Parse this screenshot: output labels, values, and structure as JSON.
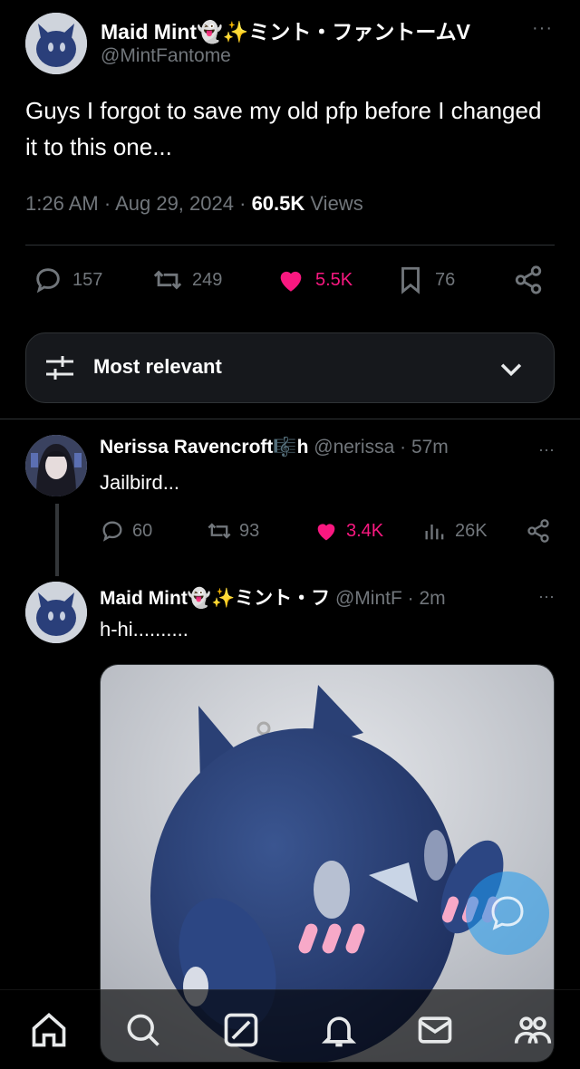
{
  "main_tweet": {
    "display_name": "Maid Mint👻✨ミント・ファントームV",
    "handle": "@MintFantome",
    "more_label": "···",
    "text": "Guys I forgot to save my old pfp before I changed it to this one...",
    "time": "1:26 AM",
    "date": "Aug 29, 2024",
    "views_count": "60.5K",
    "views_label": "Views",
    "replies": "157",
    "reposts": "249",
    "likes": "5.5K",
    "bookmarks": "76",
    "icons": [
      "reply-icon",
      "repost-icon",
      "like-icon",
      "bookmark-icon",
      "share-icon"
    ],
    "like_color": "#f91880"
  },
  "sort": {
    "label": "Most relevant",
    "icons": [
      "sliders-icon",
      "chevron-down-icon"
    ]
  },
  "replies": [
    {
      "display_name": "Nerissa Ravencroft🎼h",
      "handle": "@nerissa",
      "time": "57m",
      "text": "Jailbird...",
      "replies": "60",
      "reposts": "93",
      "likes": "3.4K",
      "views": "26K"
    },
    {
      "display_name": "Maid Mint👻✨ミント・フ",
      "handle": "@MintF",
      "time": "2m",
      "text": "h-hi..........",
      "media_icon": "plush-photo"
    }
  ],
  "nav": {
    "items": [
      "home-icon",
      "search-icon",
      "grok-icon",
      "notifications-icon",
      "messages-icon",
      "communities-icon"
    ]
  },
  "colors": {
    "background": "#000000",
    "muted": "#71767b",
    "accent": "#1d9bf0",
    "like": "#f91880"
  }
}
